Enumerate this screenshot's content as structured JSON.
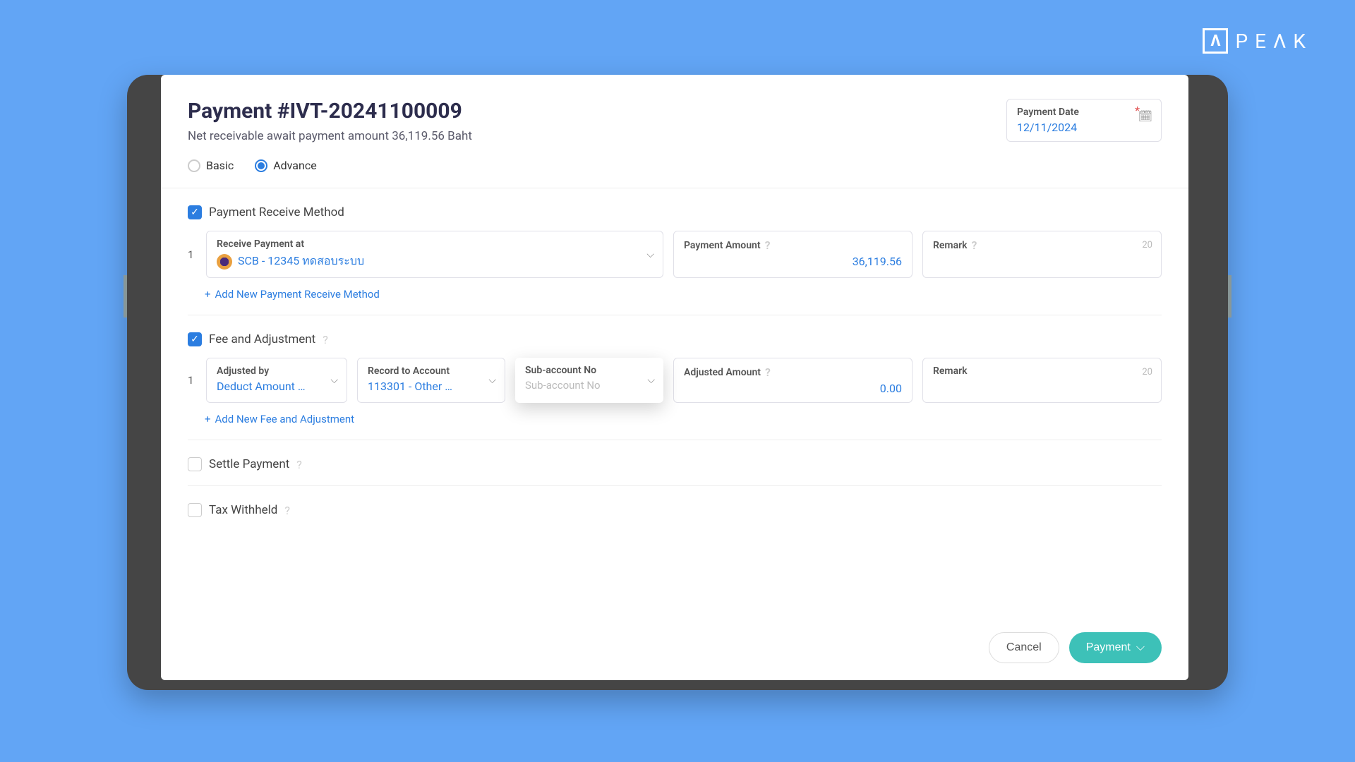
{
  "logo": {
    "icon": "Λ",
    "text": "PEΛK"
  },
  "nav": {
    "prev_icon": "‹",
    "next_icon": "›"
  },
  "header": {
    "title": "Payment #IVT-20241100009",
    "subtitle": "Net receivable await payment amount 36,119.56 Baht",
    "date_label": "Payment Date",
    "date_value": "12/11/2024"
  },
  "mode": {
    "basic_label": "Basic",
    "advance_label": "Advance"
  },
  "payment_method": {
    "title": "Payment Receive Method",
    "row_num": "1",
    "receive_label": "Receive Payment at",
    "receive_value": "SCB - 12345 ทดสอบระบบ",
    "amount_label": "Payment Amount",
    "amount_value": "36,119.56",
    "remark_label": "Remark",
    "remark_counter": "20",
    "add_label": "Add New Payment Receive Method"
  },
  "fee_adjustment": {
    "title": "Fee and Adjustment",
    "row_num": "1",
    "adjusted_by_label": "Adjusted by",
    "adjusted_by_value": "Deduct Amount …",
    "record_label": "Record to Account",
    "record_value": "113301 - Other …",
    "subaccount_label": "Sub-account No",
    "subaccount_placeholder": "Sub-account No",
    "adjusted_amount_label": "Adjusted Amount",
    "adjusted_amount_value": "0.00",
    "remark_label": "Remark",
    "remark_counter": "20",
    "add_label": "Add New Fee and Adjustment"
  },
  "settle": {
    "title": "Settle Payment"
  },
  "tax": {
    "title": "Tax Withheld"
  },
  "footer": {
    "cancel_label": "Cancel",
    "payment_label": "Payment"
  }
}
